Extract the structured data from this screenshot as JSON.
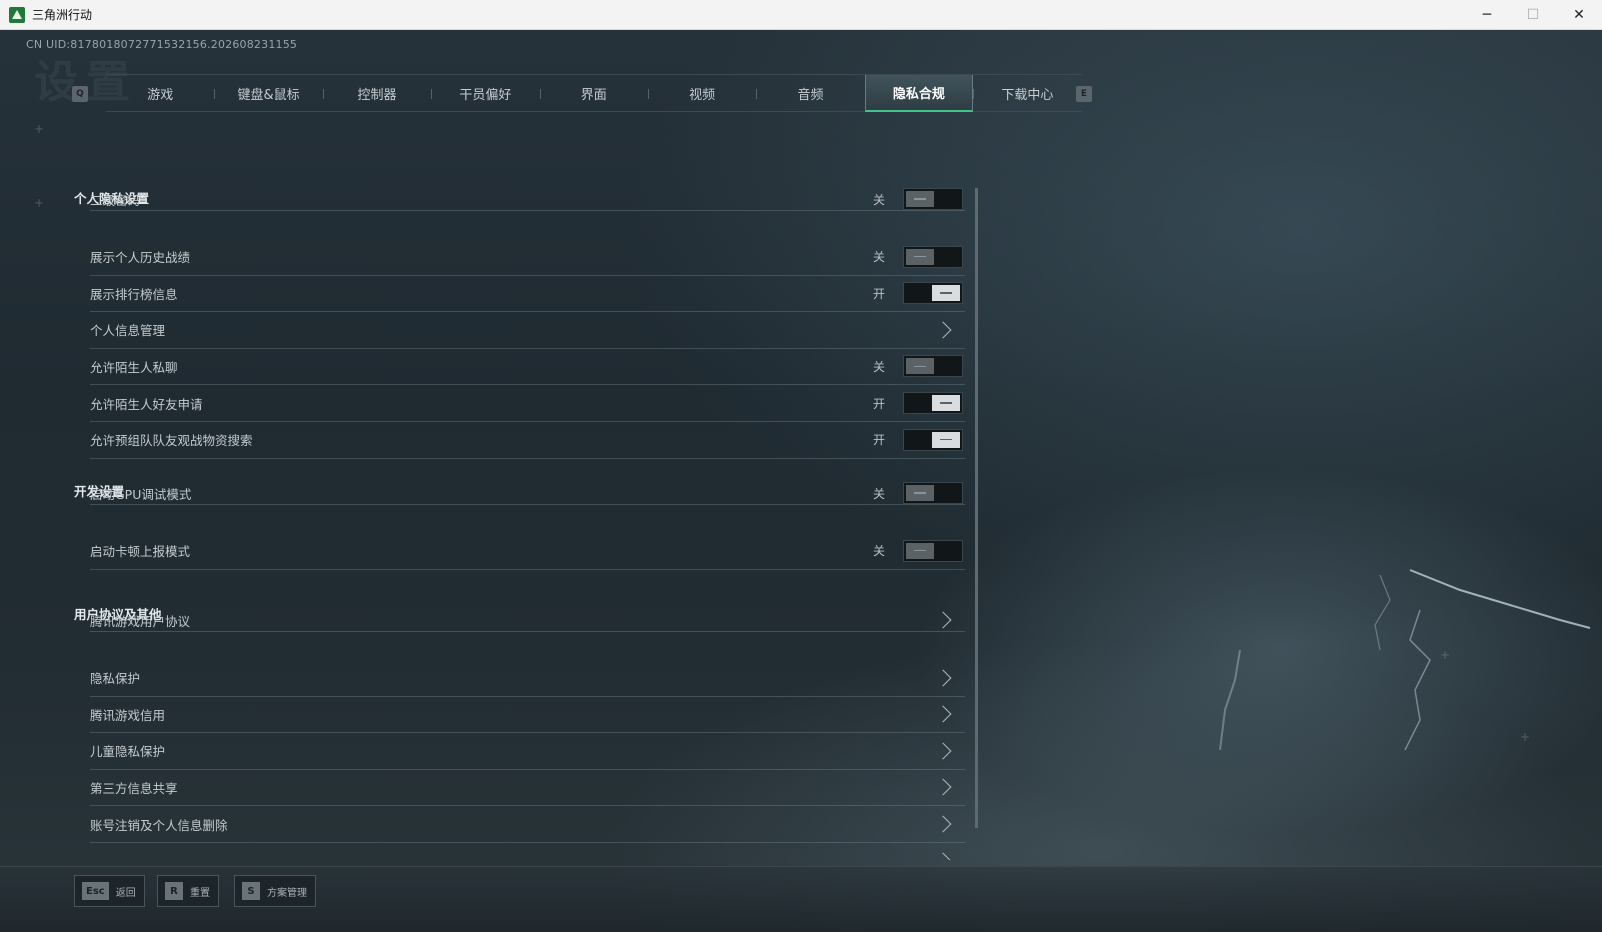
{
  "window": {
    "title": "三角洲行动",
    "controls": {
      "minimize": "─",
      "maximize": "☐",
      "close": "✕"
    }
  },
  "uid": "CN UID:8178018072771532156.202608231155",
  "background_title": "设置",
  "tabbar": {
    "left_key": "Q",
    "right_key": "E",
    "tabs": [
      {
        "label": "游戏",
        "active": false
      },
      {
        "label": "键盘&鼠标",
        "active": false
      },
      {
        "label": "控制器",
        "active": false
      },
      {
        "label": "干员偏好",
        "active": false
      },
      {
        "label": "界面",
        "active": false
      },
      {
        "label": "视频",
        "active": false
      },
      {
        "label": "音频",
        "active": false
      },
      {
        "label": "隐私合规",
        "active": true
      },
      {
        "label": "下载中心",
        "active": false
      }
    ]
  },
  "sections": {
    "privacy": {
      "title": "个人隐私设置",
      "rows": [
        {
          "label": "二级密码",
          "type": "toggle",
          "state": "关",
          "on": false
        },
        {
          "label": "展示个人历史战绩",
          "type": "toggle",
          "state": "关",
          "on": false
        },
        {
          "label": "展示排行榜信息",
          "type": "toggle",
          "state": "开",
          "on": true
        },
        {
          "label": "个人信息管理",
          "type": "link"
        },
        {
          "label": "允许陌生人私聊",
          "type": "toggle",
          "state": "关",
          "on": false
        },
        {
          "label": "允许陌生人好友申请",
          "type": "toggle",
          "state": "开",
          "on": true
        },
        {
          "label": "允许预组队队友观战物资搜索",
          "type": "toggle",
          "state": "开",
          "on": true
        }
      ]
    },
    "dev": {
      "title": "开发设置",
      "rows": [
        {
          "label": "启动GPU调试模式",
          "type": "toggle",
          "state": "关",
          "on": false
        },
        {
          "label": "启动卡顿上报模式",
          "type": "toggle",
          "state": "关",
          "on": false
        }
      ]
    },
    "agreements": {
      "title": "用户协议及其他",
      "rows": [
        {
          "label": "腾讯游戏用户协议",
          "type": "link"
        },
        {
          "label": "隐私保护",
          "type": "link"
        },
        {
          "label": "腾讯游戏信用",
          "type": "link"
        },
        {
          "label": "儿童隐私保护",
          "type": "link"
        },
        {
          "label": "第三方信息共享",
          "type": "link"
        },
        {
          "label": "账号注销及个人信息删除",
          "type": "link"
        },
        {
          "label": "",
          "type": "link"
        }
      ]
    }
  },
  "bottom_hints": [
    {
      "key": "Esc",
      "label": "返回"
    },
    {
      "key": "R",
      "label": "重置"
    },
    {
      "key": "S",
      "label": "方案管理"
    }
  ],
  "colors": {
    "accent": "#3fc48a",
    "toggle_on_knob": "#d9dde0",
    "toggle_off_knob": "#5a6266"
  }
}
